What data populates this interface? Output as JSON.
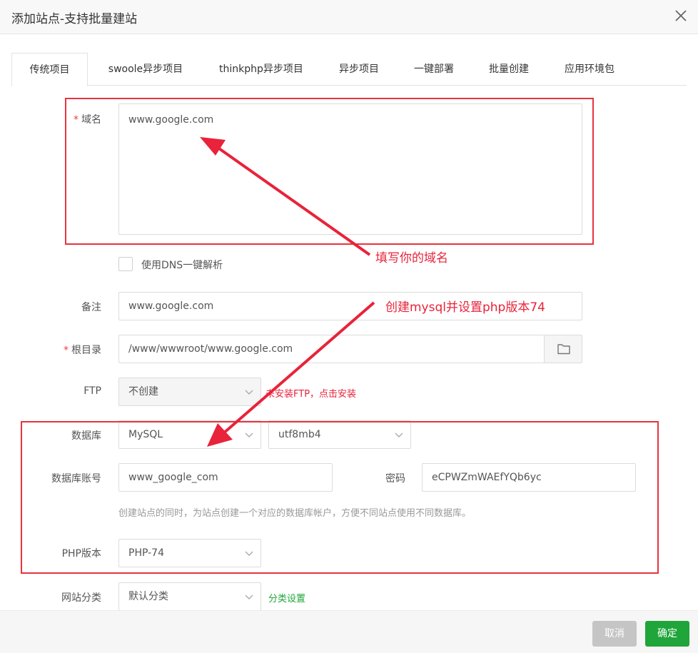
{
  "dialog": {
    "title": "添加站点-支持批量建站",
    "close_icon": "close-icon"
  },
  "tabs": [
    {
      "label": "传统项目",
      "active": true
    },
    {
      "label": "swoole异步项目",
      "active": false
    },
    {
      "label": "thinkphp异步项目",
      "active": false
    },
    {
      "label": "异步项目",
      "active": false
    },
    {
      "label": "一键部署",
      "active": false
    },
    {
      "label": "批量创建",
      "active": false
    },
    {
      "label": "应用环境包",
      "active": false
    }
  ],
  "form": {
    "domain": {
      "required_mark": "*",
      "label": "域名",
      "value": "www.google.com"
    },
    "dns": {
      "label": "使用DNS一键解析",
      "checked": false
    },
    "remark": {
      "label": "备注",
      "value": "www.google.com"
    },
    "root": {
      "required_mark": "*",
      "label": "根目录",
      "value": "/www/wwwroot/www.google.com",
      "icon": "folder-icon"
    },
    "ftp": {
      "label": "FTP",
      "value": "不创建",
      "notice": "未安装FTP，点击安装"
    },
    "database": {
      "label": "数据库",
      "type": "MySQL",
      "charset": "utf8mb4"
    },
    "db_account": {
      "label": "数据库账号",
      "value": "www_google_com",
      "password_label": "密码",
      "password_value": "eCPWZmWAEfYQb6yc"
    },
    "db_hint": "创建站点的同时，为站点创建一个对应的数据库帐户，方便不同站点使用不同数据库。",
    "php": {
      "label": "PHP版本",
      "value": "PHP-74"
    },
    "category": {
      "label": "网站分类",
      "value": "默认分类",
      "link": "分类设置"
    }
  },
  "annotations": {
    "domain_note": "填写你的域名",
    "mysql_note": "创建mysql并设置php版本74"
  },
  "footer": {
    "cancel_label": "取消",
    "confirm_label": "确定"
  },
  "colors": {
    "accent_green": "#20a53a",
    "annotation_red": "#e8233a",
    "cancel_gray": "#c5c5c5"
  }
}
